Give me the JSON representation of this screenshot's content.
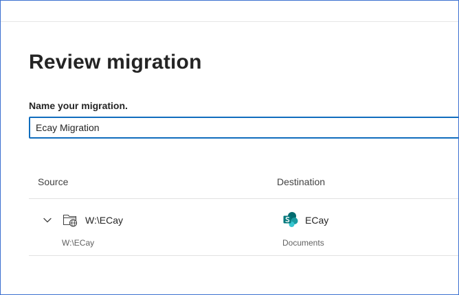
{
  "page": {
    "title": "Review migration"
  },
  "form": {
    "name_label": "Name your migration.",
    "name_value": "Ecay Migration"
  },
  "table": {
    "headers": {
      "source": "Source",
      "destination": "Destination"
    },
    "rows": [
      {
        "source_name": "W:\\ECay",
        "source_path": "W:\\ECay",
        "source_icon": "network-folder-icon",
        "destination_name": "ECay",
        "destination_library": "Documents",
        "destination_icon": "sharepoint-icon"
      }
    ]
  },
  "colors": {
    "accent": "#0f6cbd",
    "frame_border": "#3a6fd0",
    "sharepoint_teal": "#03787c"
  }
}
